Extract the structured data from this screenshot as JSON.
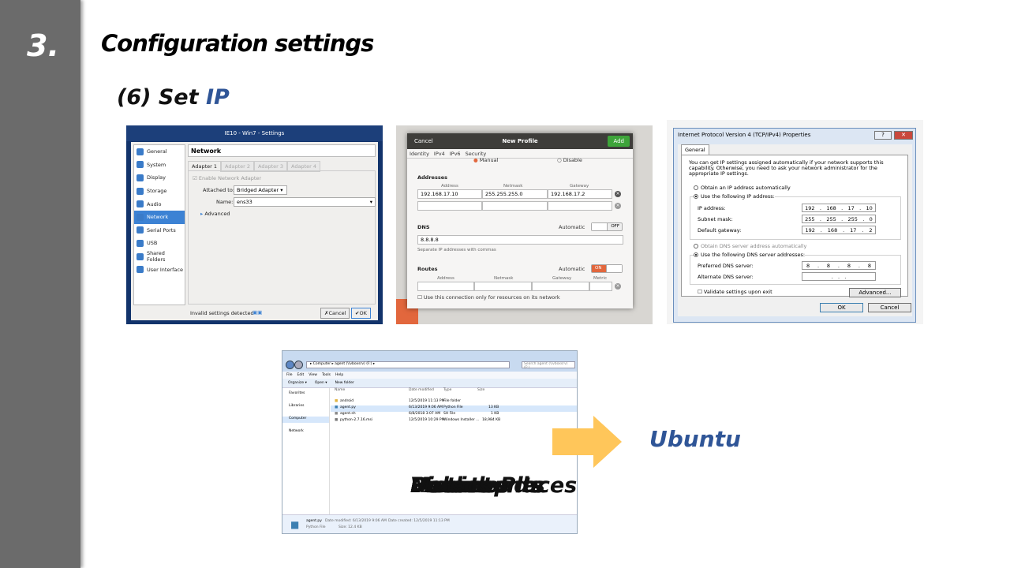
{
  "slide": {
    "section_number": "3.",
    "title": "Configuration settings",
    "subtitle_prefix": "(6) Set ",
    "subtitle_highlight": "IP",
    "side_label": "Ubuntu"
  },
  "virtualbox": {
    "window_title": "IE10 - Win7 - Settings",
    "nav": [
      {
        "label": "General"
      },
      {
        "label": "System"
      },
      {
        "label": "Display"
      },
      {
        "label": "Storage"
      },
      {
        "label": "Audio"
      },
      {
        "label": "Network",
        "selected": true
      },
      {
        "label": "Serial Ports"
      },
      {
        "label": "USB"
      },
      {
        "label": "Shared Folders"
      },
      {
        "label": "User Interface"
      }
    ],
    "section": "Network",
    "tabs": [
      "Adapter 1",
      "Adapter 2",
      "Adapter 3",
      "Adapter 4"
    ],
    "enable_label": "Enable Network Adapter",
    "attached_label": "Attached to:",
    "attached_value": "Bridged Adapter",
    "name_label": "Name:",
    "name_value": "ens33",
    "advanced_label": "Advanced",
    "status": "Invalid settings detected",
    "cancel": "Cancel",
    "ok": "OK"
  },
  "gnome": {
    "cancel": "Cancel",
    "title": "New Profile",
    "add": "Add",
    "tabs": [
      "Identity",
      "IPv4",
      "IPv6",
      "Security"
    ],
    "manual": "Manual",
    "disable": "Disable",
    "addresses_label": "Addresses",
    "col_address": "Address",
    "col_netmask": "Netmask",
    "col_gateway": "Gateway",
    "address": "192.168.17.10",
    "netmask": "255.255.255.0",
    "gateway": "192.168.17.2",
    "dns_label": "DNS",
    "automatic": "Automatic",
    "dns_toggle": "OFF",
    "dns_value": "8.8.8.8",
    "dns_hint": "Separate IP addresses with commas",
    "routes_label": "Routes",
    "routes_toggle": "ON",
    "col_metric": "Metric",
    "only_resources": "Use this connection only for resources on its network"
  },
  "windows_ipv4": {
    "title": "Internet Protocol Version 4 (TCP/IPv4) Properties",
    "tab": "General",
    "intro": "You can get IP settings assigned automatically if your network supports this capability. Otherwise, you need to ask your network administrator for the appropriate IP settings.",
    "obtain_auto": "Obtain an IP address automatically",
    "use_following": "Use the following IP address:",
    "ip_label": "IP address:",
    "ip": [
      "192",
      "168",
      "17",
      "10"
    ],
    "mask_label": "Subnet mask:",
    "mask": [
      "255",
      "255",
      "255",
      "0"
    ],
    "gw_label": "Default gateway:",
    "gw": [
      "192",
      "168",
      "17",
      "2"
    ],
    "dns_auto": "Obtain DNS server address automatically",
    "dns_use": "Use the following DNS server addresses:",
    "pref_label": "Preferred DNS server:",
    "pref": [
      "8",
      "8",
      "8",
      "8"
    ],
    "alt_label": "Alternate DNS server:",
    "validate": "Validate settings upon exit",
    "advanced": "Advanced...",
    "ok": "OK",
    "cancel": "Cancel"
  },
  "explorer": {
    "path": "▸ Computer ▸ agent (\\\\vboxsrv) (F:) ▸",
    "search": "Search agent (\\\\vboxsrv) (F:)",
    "menu": [
      "File",
      "Edit",
      "View",
      "Tools",
      "Help"
    ],
    "cmd": [
      "Organize ▾",
      "Open ▾",
      "New folder"
    ],
    "nav": [
      "Favorites",
      "Desktop",
      "Downloads",
      "Recent Places",
      "Libraries",
      "Documents",
      "Music",
      "Pictures",
      "Videos",
      "Computer",
      "Network"
    ],
    "cols": [
      "Name",
      "Date modified",
      "Type",
      "Size"
    ],
    "files": [
      {
        "name": "android",
        "date": "12/5/2019 11:13 PM",
        "type": "File folder",
        "size": ""
      },
      {
        "name": "agent.py",
        "date": "6/13/2019 9:06 AM",
        "type": "Python File",
        "size": "13 KB"
      },
      {
        "name": "agent.sh",
        "date": "6/8/2018 3:07 AM",
        "type": "SH File",
        "size": "1 KB"
      },
      {
        "name": "python-2.7.16.msi",
        "date": "12/5/2019 10:29 PM",
        "type": "Windows Installer ...",
        "size": "18,984 KB"
      }
    ],
    "detail_name": "agent.py",
    "detail_type": "Python File",
    "detail_modified": "Date modified: 6/13/2019 9:06 AM",
    "detail_size": "Size: 12.4 KB",
    "detail_created": "Date created: 12/5/2019 11:13 PM"
  },
  "colors": {
    "accent": "#2f5597",
    "sidebar": "#6b6b6b",
    "arrow": "#ffc65a"
  }
}
